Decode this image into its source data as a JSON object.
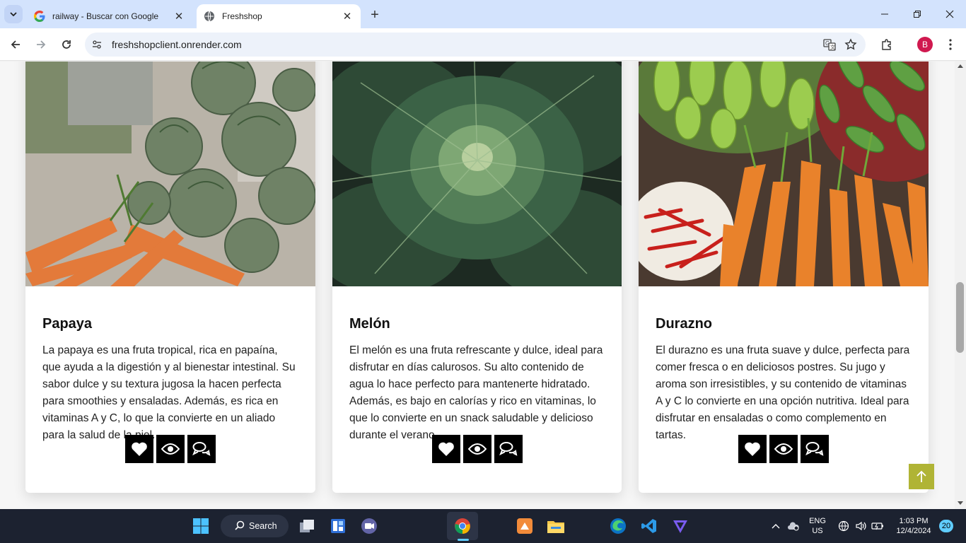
{
  "browser": {
    "tabs": [
      {
        "title": "railway - Buscar con Google",
        "active": false
      },
      {
        "title": "Freshshop",
        "active": true
      }
    ],
    "url": "freshshopclient.onrender.com",
    "profile_initial": "B"
  },
  "products": [
    {
      "name": "Papaya",
      "description": "La papaya es una fruta tropical, rica en papaína, que ayuda a la digestión y al bienestar intestinal. Su sabor dulce y su textura jugosa la hacen perfecta para smoothies y ensaladas. Además, es rica en vitaminas A y C, lo que la convierte en un aliado para la salud de la piel.",
      "image": "artichokes-and-carrots-photo"
    },
    {
      "name": "Melón",
      "description": "El melón es una fruta refrescante y dulce, ideal para disfrutar en días calurosos. Su alto contenido de agua lo hace perfecto para mantenerte hidratado. Además, es bajo en calorías y rico en vitaminas, lo que lo convierte en un snack saludable y delicioso durante el verano.",
      "image": "cabbage-photo"
    },
    {
      "name": "Durazno",
      "description": "El durazno es una fruta suave y dulce, perfecta para comer fresca o en deliciosos postres. Su jugo y aroma son irresistibles, y su contenido de vitaminas A y C lo convierte en una opción nutritiva. Ideal para disfrutar en ensaladas o como complemento en tartas.",
      "image": "market-vegetables-photo"
    }
  ],
  "card_actions": [
    "heart-icon",
    "eye-icon",
    "comments-icon"
  ],
  "colors": {
    "scroll_top_button": "#b0b435",
    "action_button": "#000000"
  },
  "taskbar": {
    "search_label": "Search",
    "language": "ENG",
    "region": "US",
    "time": "1:03 PM",
    "date": "12/4/2024",
    "notifications": "20"
  }
}
